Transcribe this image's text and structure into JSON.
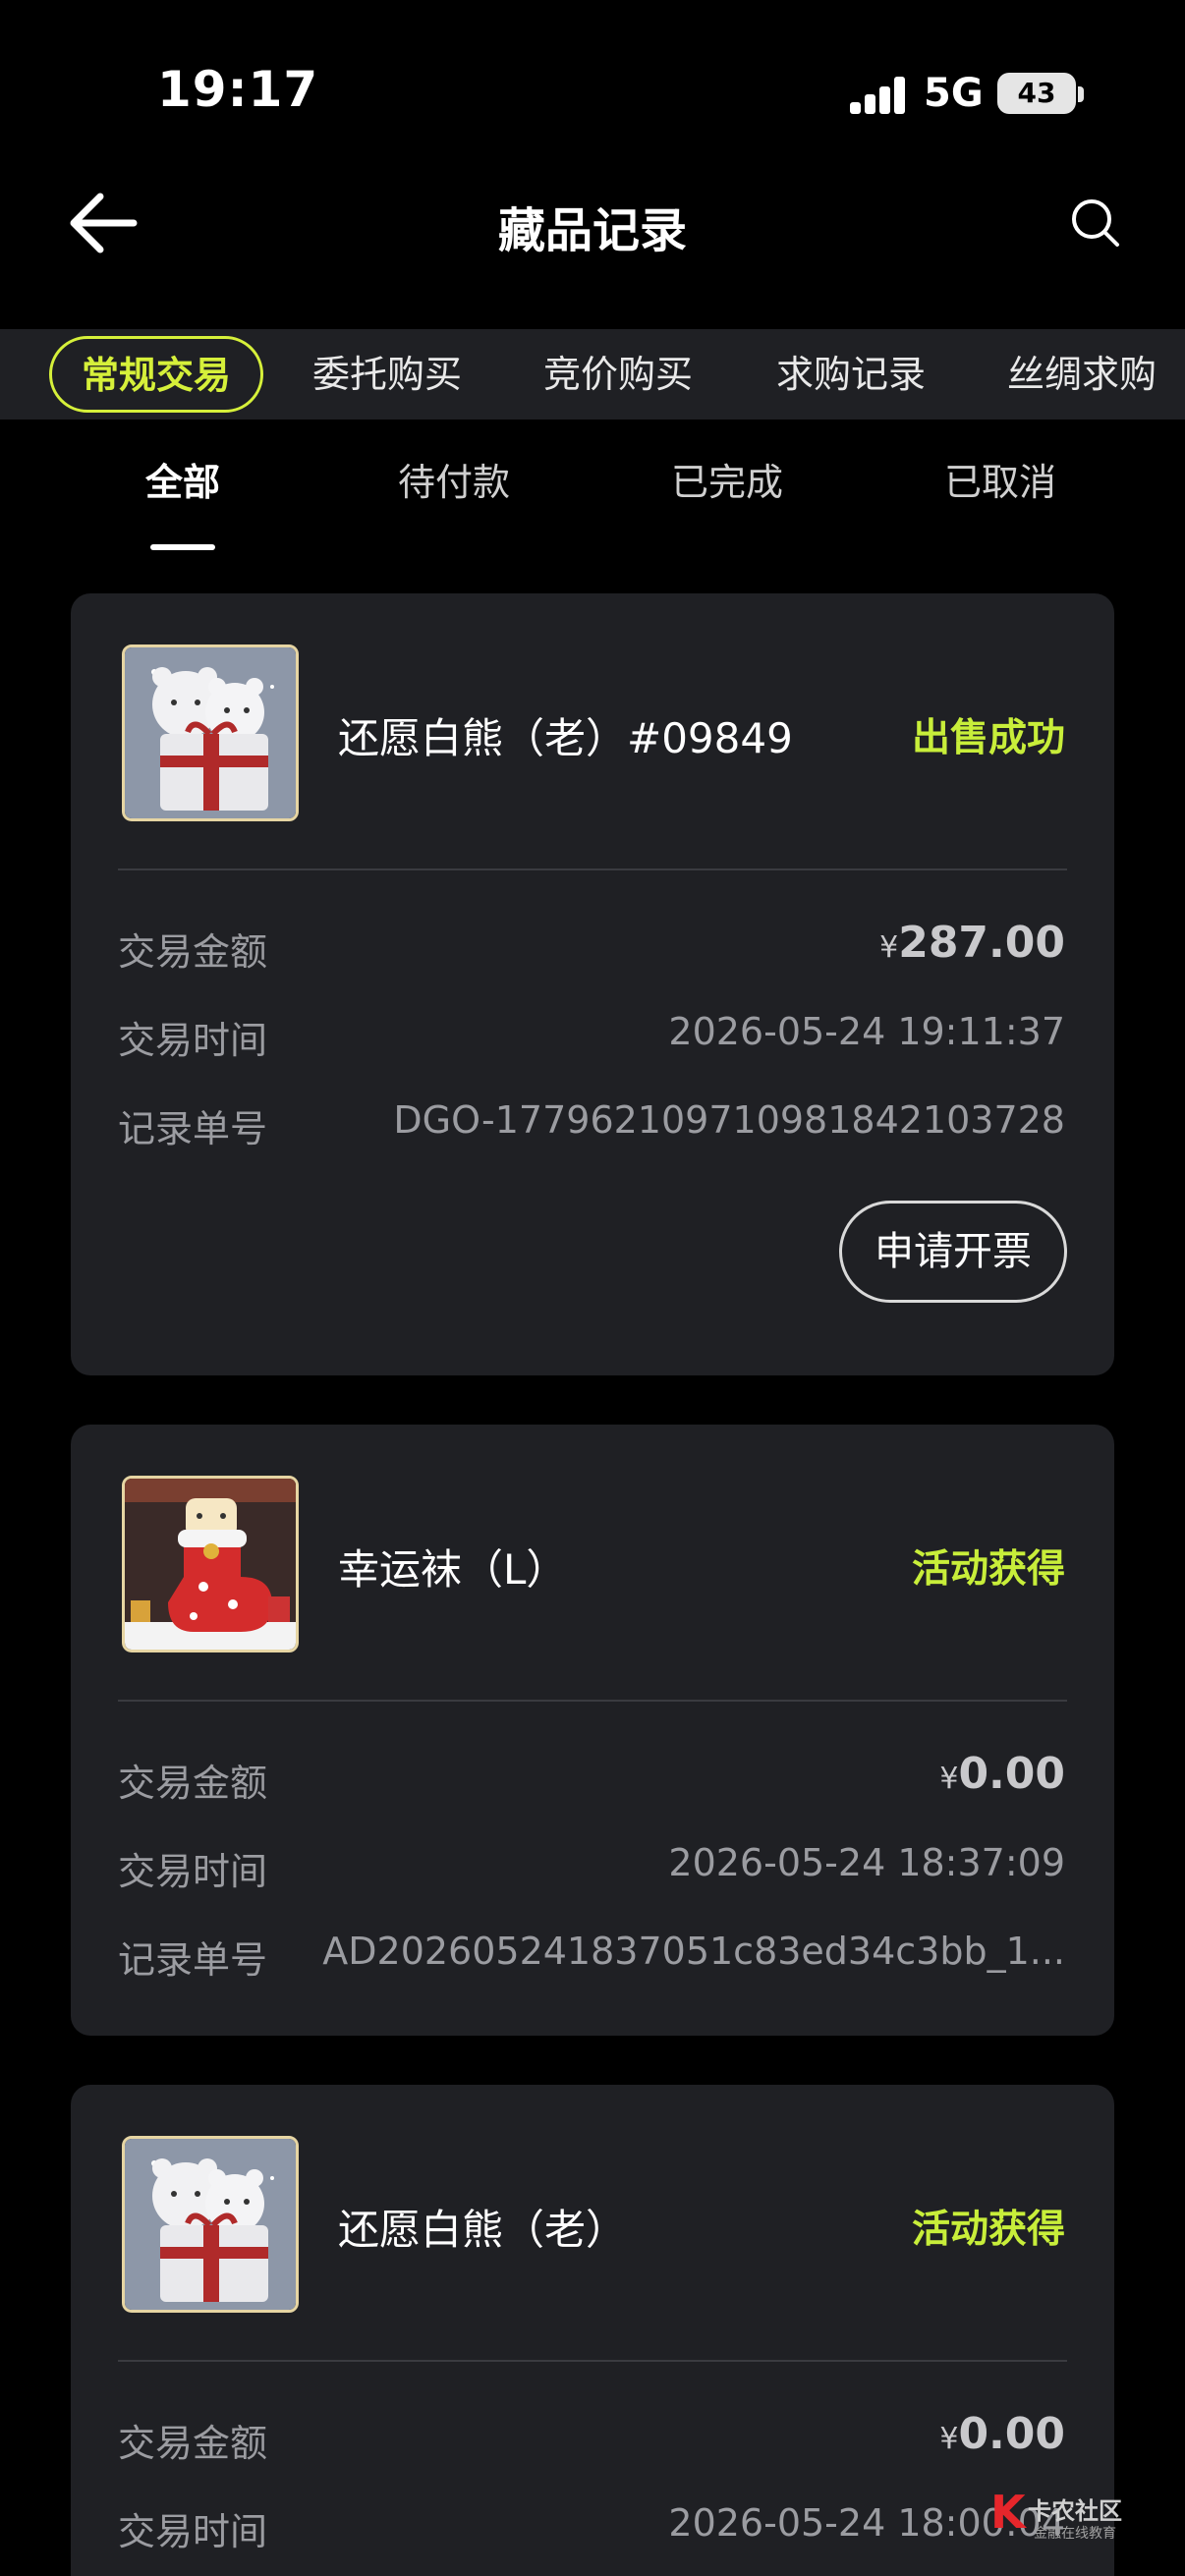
{
  "status_bar": {
    "time": "19:17",
    "network": "5G",
    "battery": "43"
  },
  "header": {
    "title": "藏品记录"
  },
  "tabs": [
    {
      "label": "常规交易",
      "active": true
    },
    {
      "label": "委托购买",
      "active": false
    },
    {
      "label": "竞价购买",
      "active": false
    },
    {
      "label": "求购记录",
      "active": false
    },
    {
      "label": "丝绸求购",
      "active": false
    }
  ],
  "subtabs": [
    {
      "label": "全部",
      "active": true
    },
    {
      "label": "待付款",
      "active": false
    },
    {
      "label": "已完成",
      "active": false
    },
    {
      "label": "已取消",
      "active": false
    }
  ],
  "labels": {
    "amount": "交易金额",
    "time": "交易时间",
    "order_no": "记录单号",
    "currency": "¥"
  },
  "records": [
    {
      "name": "还愿白熊（老）#09849",
      "status": "出售成功",
      "amount": "287.00",
      "time": "2026-05-24 19:11:37",
      "order_no": "DGO-17796210971098184​2103728",
      "action": "申请开票",
      "image": "polar-bear-gift-icon"
    },
    {
      "name": "幸运袜（L）",
      "status": "活动获得",
      "amount": "0.00",
      "time": "2026-05-24 18:37:09",
      "order_no": "AD202605241837051c83ed34c3bb_1...",
      "image": "christmas-stocking-icon"
    },
    {
      "name": "还愿白熊（老）",
      "status": "活动获得",
      "amount": "0.00",
      "time": "2026-05-24 18:00:04",
      "image": "polar-bear-gift-icon"
    }
  ],
  "watermark": {
    "brand": "卡农社区",
    "sub": "金融在线教育"
  },
  "colors": {
    "accent": "#c8ee3a",
    "card_bg": "#1f2024",
    "page_bg": "#000000"
  }
}
